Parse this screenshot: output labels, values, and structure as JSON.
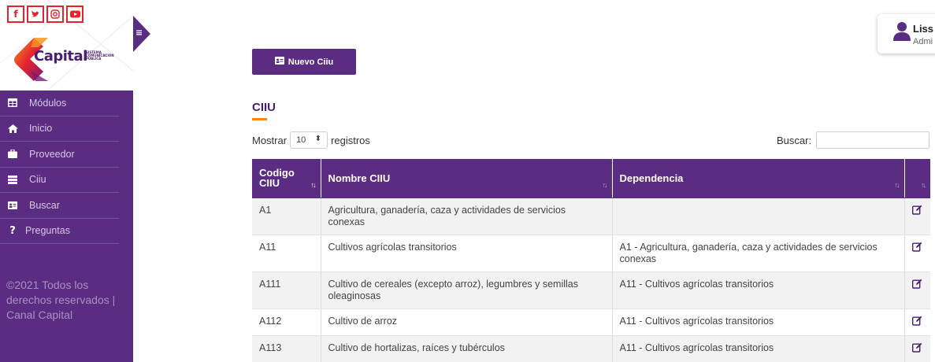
{
  "social": [
    {
      "icon": "facebook-icon",
      "glyph": "f"
    },
    {
      "icon": "twitter-icon",
      "glyph": "🐦"
    },
    {
      "icon": "instagram-icon",
      "glyph": "◎"
    },
    {
      "icon": "youtube-icon",
      "glyph": "▶"
    }
  ],
  "brand": {
    "name": "Capital",
    "small": "SISTEMA\nCOMUNICACIÓN\nPÚBLICA"
  },
  "sidebar": {
    "items": [
      {
        "label": "Módulos",
        "icon": "table-icon",
        "glyph": "▦"
      },
      {
        "label": "Inicio",
        "icon": "home-icon",
        "glyph": "⌂"
      },
      {
        "label": "Proveedor",
        "icon": "briefcase-icon",
        "glyph": "■"
      },
      {
        "label": "Ciiu",
        "icon": "server-icon",
        "glyph": "☰"
      },
      {
        "label": "Buscar",
        "icon": "id-card-icon",
        "glyph": "▣"
      },
      {
        "label": "Preguntas",
        "icon": "question-icon",
        "glyph": "?"
      }
    ],
    "copyright": "©2021 Todos los derechos reservados | Canal Capital"
  },
  "user": {
    "name": "Liss",
    "role": "Admi"
  },
  "toolbar": {
    "new_label": "Nuevo Ciiu"
  },
  "section": {
    "title": "CIIU"
  },
  "length": {
    "prefix": "Mostrar",
    "value": "10",
    "suffix": "registros"
  },
  "search": {
    "label": "Buscar:",
    "value": ""
  },
  "table": {
    "headers": [
      {
        "label": "Codigo CIIU",
        "sort": "↑↓"
      },
      {
        "label": "Nombre CIIU",
        "sort": "↑↓"
      },
      {
        "label": "Dependencia",
        "sort": "↑↓"
      },
      {
        "label": "",
        "sort": "↑↓"
      }
    ],
    "rows": [
      {
        "code": "A1",
        "name": "Agricultura, ganadería, caza y actividades de servicios conexas",
        "dep": ""
      },
      {
        "code": "A11",
        "name": "Cultivos agrícolas transitorios",
        "dep": "A1 - Agricultura, ganadería, caza y actividades de servicios conexas"
      },
      {
        "code": "A111",
        "name": "Cultivo de cereales (excepto arroz), legumbres y semillas oleaginosas",
        "dep": "A11 - Cultivos agrícolas transitorios"
      },
      {
        "code": "A112",
        "name": "Cultivo de arroz",
        "dep": "A11 - Cultivos agrícolas transitorios"
      },
      {
        "code": "A113",
        "name": "Cultivo de hortalizas, raíces y tubérculos",
        "dep": "A11 - Cultivos agrícolas transitorios"
      }
    ]
  },
  "colors": {
    "primary": "#5b2d82",
    "accent": "#f08a1c",
    "social": "#e5232f"
  }
}
